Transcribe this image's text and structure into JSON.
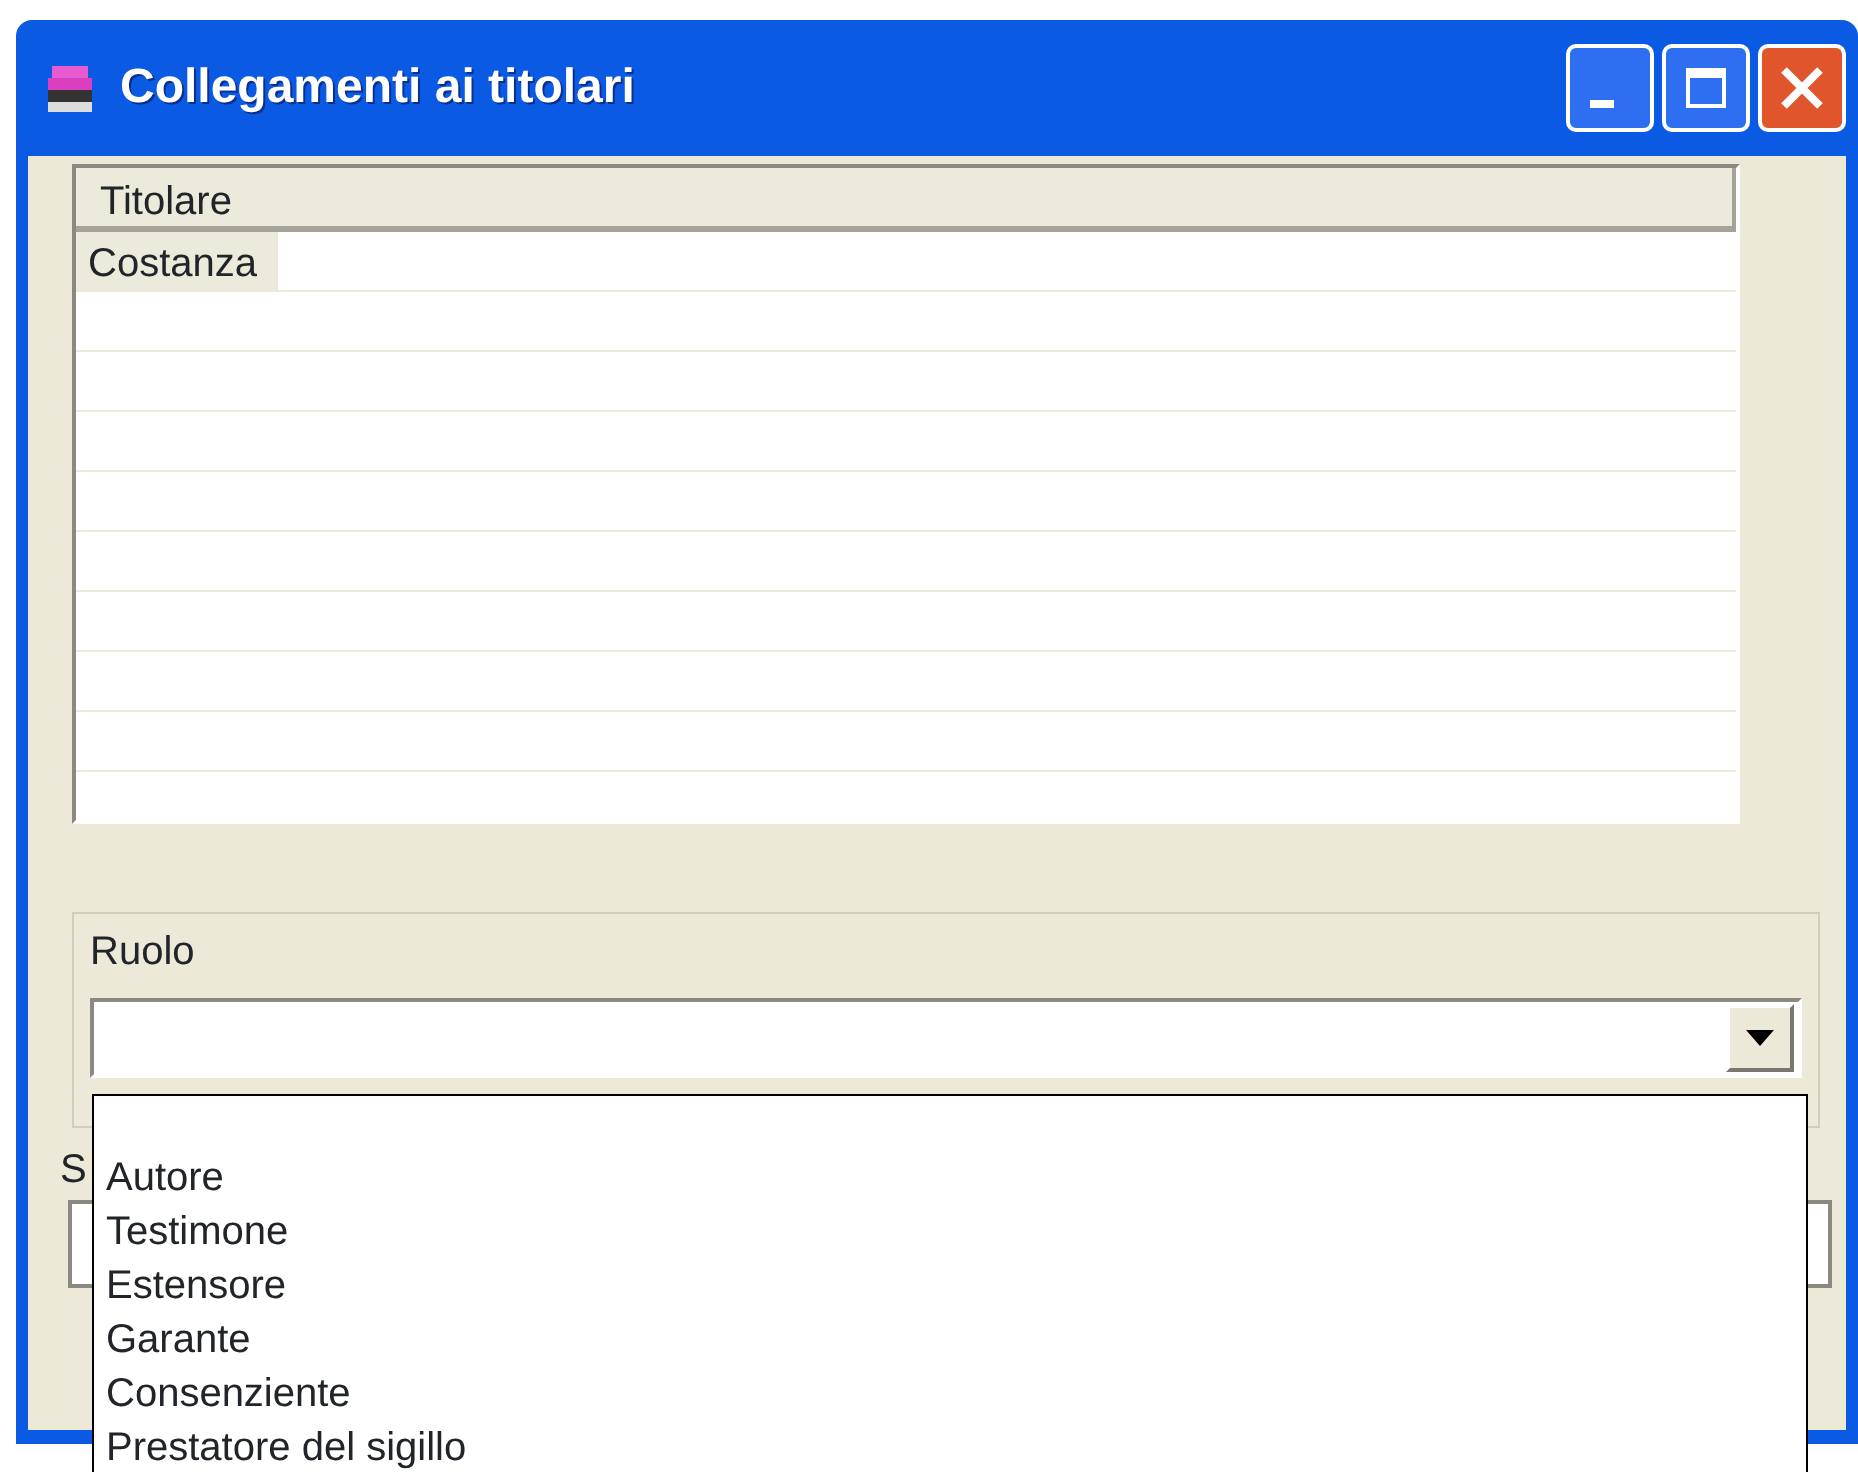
{
  "window": {
    "title": "Collegamenti ai titolari"
  },
  "table": {
    "columns": [
      "Titolare"
    ],
    "rows": [
      [
        "Costanza"
      ]
    ]
  },
  "role_group": {
    "label": "Ruolo",
    "combo": {
      "expanded": true,
      "options": [
        "Autore",
        "Testimone",
        "Estensore",
        "Garante",
        "Consenziente",
        "Prestatore del sigillo"
      ]
    }
  },
  "hidden_field": {
    "label": "S"
  }
}
